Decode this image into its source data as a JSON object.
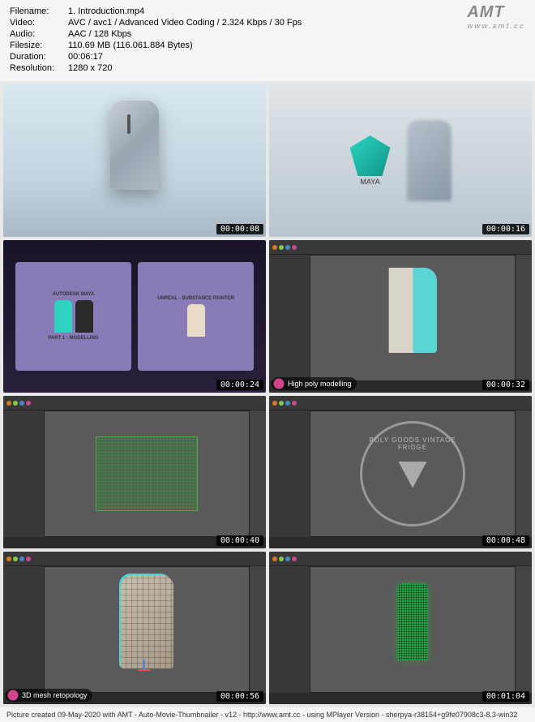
{
  "logo": {
    "main": "AMT",
    "sub": "www.amt.cc"
  },
  "info": {
    "filename_label": "Filename:",
    "filename": "1. Introduction.mp4",
    "video_label": "Video:",
    "video": "AVC / avc1 / Advanced Video Coding / 2.324 Kbps / 30 Fps",
    "audio_label": "Audio:",
    "audio": "AAC / 128 Kbps",
    "filesize_label": "Filesize:",
    "filesize": "110.69 MB (116.061.884 Bytes)",
    "duration_label": "Duration:",
    "duration": "00:06:17",
    "resolution_label": "Resolution:",
    "resolution": "1280 x 720"
  },
  "thumbs": [
    {
      "ts": "00:00:08"
    },
    {
      "ts": "00:00:16",
      "maya": "MAYA"
    },
    {
      "ts": "00:00:24",
      "panel1": "AUTODESK MAYA",
      "panel2": "UNREAL · SUBSTANCE PAINTER",
      "part": "PART 1 - MODELLING"
    },
    {
      "ts": "00:00:32",
      "badge": "High poly modelling"
    },
    {
      "ts": "00:00:40"
    },
    {
      "ts": "00:00:48",
      "circle": "POLY GOODS VINTAGE FRIDGE"
    },
    {
      "ts": "00:00:56",
      "badge": "3D mesh retopology"
    },
    {
      "ts": "00:01:04"
    }
  ],
  "footer": "Picture created 09-May-2020 with AMT - Auto-Movie-Thumbnailer - v12 - http://www.amt.cc - using MPlayer Version - sherpya-r38154+g9fe07908c3-8.3-win32"
}
